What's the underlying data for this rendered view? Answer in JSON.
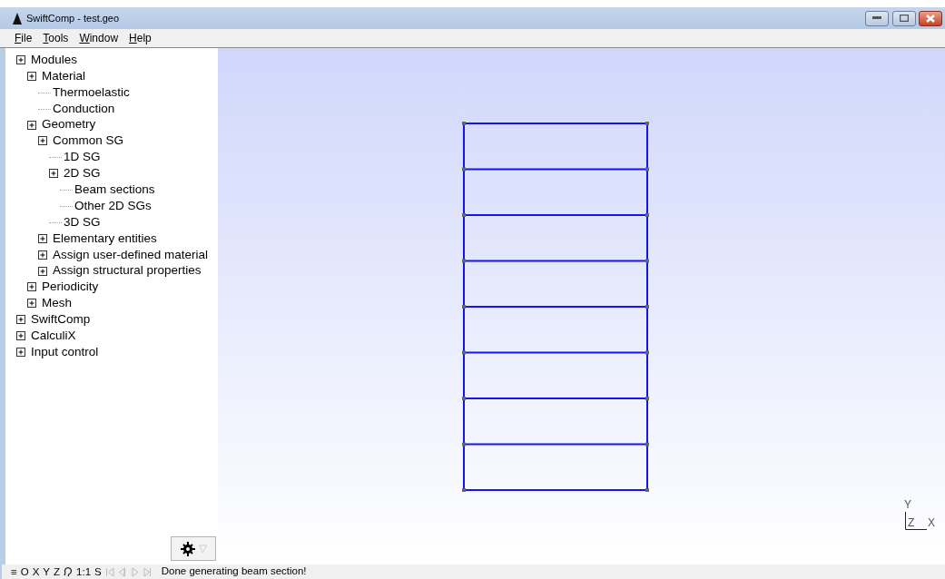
{
  "window": {
    "title": "SwiftComp - test.geo"
  },
  "menu": [
    {
      "label": "File"
    },
    {
      "label": "Tools"
    },
    {
      "label": "Window"
    },
    {
      "label": "Help"
    }
  ],
  "tree": [
    {
      "label": "Modules",
      "expander": true,
      "children": [
        {
          "label": "Material",
          "expander": true,
          "children": [
            {
              "label": "Thermoelastic",
              "expander": false
            },
            {
              "label": "Conduction",
              "expander": false
            }
          ]
        },
        {
          "label": "Geometry",
          "expander": true,
          "children": [
            {
              "label": "Common SG",
              "expander": true,
              "children": [
                {
                  "label": "1D SG",
                  "expander": false
                },
                {
                  "label": "2D SG",
                  "expander": true,
                  "children": [
                    {
                      "label": "Beam sections",
                      "expander": false
                    },
                    {
                      "label": "Other 2D SGs",
                      "expander": false
                    }
                  ]
                },
                {
                  "label": "3D SG",
                  "expander": false
                }
              ]
            },
            {
              "label": "Elementary entities",
              "expander": true
            },
            {
              "label": "Assign user-defined material",
              "expander": true
            },
            {
              "label": "Assign structural properties",
              "expander": true
            }
          ]
        },
        {
          "label": "Periodicity",
          "expander": true
        },
        {
          "label": "Mesh",
          "expander": true
        }
      ]
    },
    {
      "label": "SwiftComp",
      "expander": true
    },
    {
      "label": "CalculiX",
      "expander": true
    },
    {
      "label": "Input control",
      "expander": true
    }
  ],
  "axes": {
    "y": "Y",
    "z": "Z",
    "x": "X"
  },
  "status_bar": {
    "buttons": [
      {
        "kind": "text",
        "label": "≡"
      },
      {
        "kind": "text",
        "label": "O"
      },
      {
        "kind": "text",
        "label": "X"
      },
      {
        "kind": "text",
        "label": "Y"
      },
      {
        "kind": "text",
        "label": "Z"
      },
      {
        "kind": "rotate"
      },
      {
        "kind": "text",
        "label": "1:1"
      },
      {
        "kind": "text",
        "label": "S"
      }
    ],
    "playback": [
      {
        "kind": "first",
        "disabled": true
      },
      {
        "kind": "prev",
        "disabled": true
      },
      {
        "kind": "play",
        "disabled": true
      },
      {
        "kind": "last",
        "disabled": true
      }
    ],
    "message": "Done generating beam section!"
  }
}
